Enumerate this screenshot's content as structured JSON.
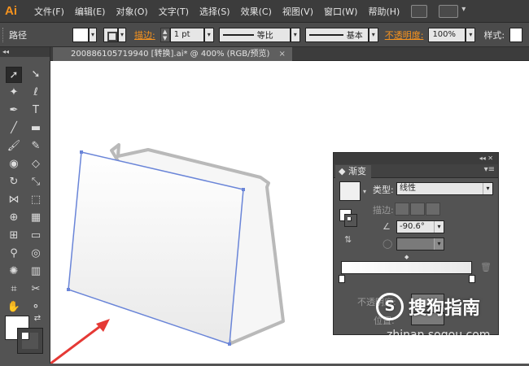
{
  "app": {
    "logo": "Ai"
  },
  "menubar": {
    "items": [
      "文件(F)",
      "编辑(E)",
      "对象(O)",
      "文字(T)",
      "选择(S)",
      "效果(C)",
      "视图(V)",
      "窗口(W)",
      "帮助(H)"
    ]
  },
  "control_bar": {
    "selection_label": "路径",
    "stroke_label": "描边:",
    "stroke_weight": "1 pt",
    "profile_label": "等比",
    "brush_label": "基本",
    "opacity_label": "不透明度:",
    "opacity_value": "100%",
    "style_label": "样式:"
  },
  "document_tab": {
    "title": "200886105719940 [转换].ai* @ 400% (RGB/预览)",
    "close": "×"
  },
  "gradient_panel": {
    "tab_title": "渐变",
    "type_label": "类型:",
    "type_value": "线性",
    "stroke_label": "描边:",
    "angle_value": "-90.6°",
    "opacity_label": "不透明度:",
    "location_label": "位置:"
  },
  "watermark": {
    "brand": "搜狗指南",
    "url": "zhinan.sogou.com"
  },
  "colors": {
    "orange": "#f7931e",
    "path_blue": "#6a85d8",
    "arrow_red": "#e53935"
  }
}
